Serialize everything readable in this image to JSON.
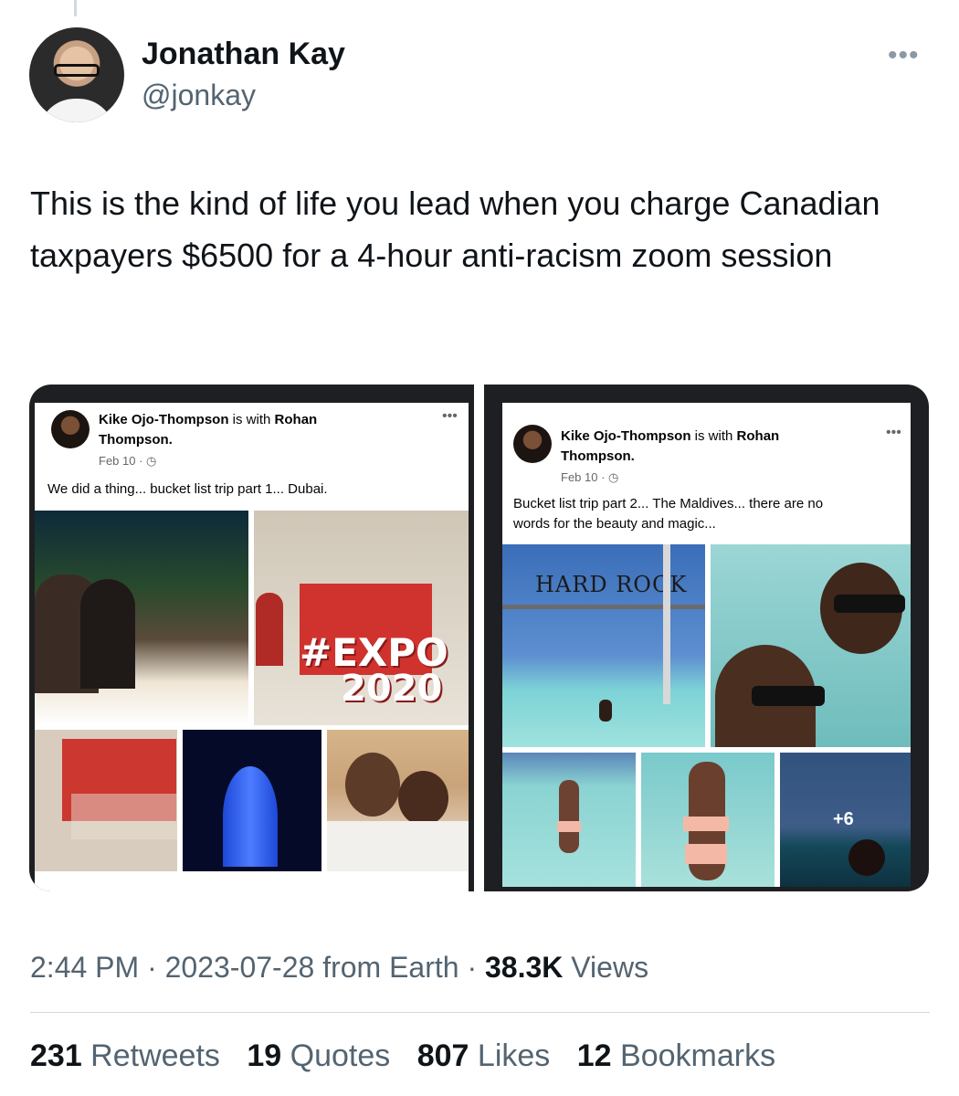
{
  "author": {
    "name": "Jonathan Kay",
    "handle": "@jonkay"
  },
  "more_icon": "•••",
  "tweet_text": "This is the kind of life you lead when you charge Canadian taxpayers $6500 for a 4-hour anti-racism zoom session",
  "media": [
    {
      "author": "Kike Ojo-Thompson",
      "with_text": "is with",
      "tagged": "Rohan",
      "tagged_line2": "Thompson.",
      "date": "Feb 10 · ◷",
      "dots": "•••",
      "caption": "We did a thing... bucket list trip part 1... Dubai.",
      "overlay_expo": "#EXPO",
      "overlay_year": "2020"
    },
    {
      "author": "Kike Ojo-Thompson",
      "with_text": "is with",
      "tagged": "Rohan",
      "tagged_line2": "Thompson.",
      "date": "Feb 10 · ◷",
      "dots": "•••",
      "caption_line1": "Bucket list trip part 2... The Maldives... there are no",
      "caption_line2": "words for the beauty and magic...",
      "sign": "HARD ROCK",
      "more_photos": "+6"
    }
  ],
  "meta": {
    "time": "2:44 PM",
    "sep": " · ",
    "date": "2023-07-28",
    "source": " from Earth",
    "views": "38.3K",
    "views_label": " Views"
  },
  "stats": [
    {
      "count": "231",
      "label": " Retweets"
    },
    {
      "count": "19",
      "label": " Quotes"
    },
    {
      "count": "807",
      "label": " Likes"
    },
    {
      "count": "12",
      "label": " Bookmarks"
    }
  ],
  "colors": {
    "text": "#0f1419",
    "secondary": "#536471",
    "divider": "#cfd9de",
    "media_frame": "#1d1f22"
  }
}
